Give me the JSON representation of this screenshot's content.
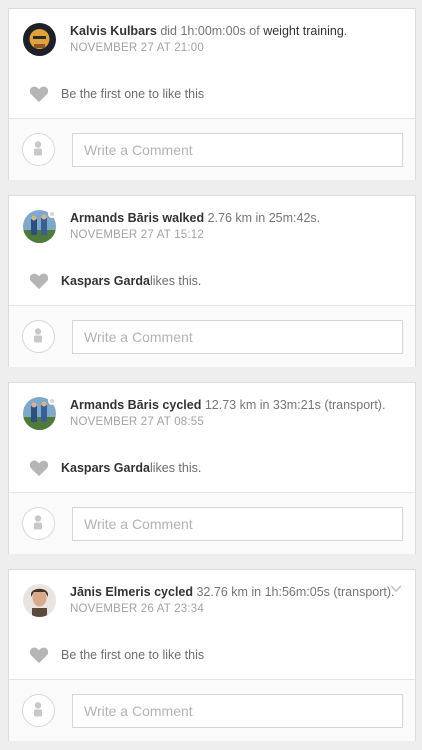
{
  "feed": [
    {
      "user": "Kalvis Kulbars",
      "verb": " did ",
      "detail": "1h:00m:00s of ",
      "activity": "weight training",
      "suffix": ".",
      "timestamp": "NOVEMBER 27 AT 21:00",
      "likes_name": "",
      "likes_text": "Be the first one to like this",
      "comment_placeholder": "Write a Comment"
    },
    {
      "user": "Armands Bāris",
      "verb": " walked ",
      "detail": "2.76 km in 25m:42s.",
      "activity": "",
      "suffix": "",
      "timestamp": "NOVEMBER 27 AT 15:12",
      "likes_name": "Kaspars Garda",
      "likes_text": " likes this.",
      "comment_placeholder": "Write a Comment"
    },
    {
      "user": "Armands Bāris",
      "verb": " cycled ",
      "detail": "12.73 km in 33m:21s (transport).",
      "activity": "",
      "suffix": "",
      "timestamp": "NOVEMBER 27 AT 08:55",
      "likes_name": "Kaspars Garda",
      "likes_text": " likes this.",
      "comment_placeholder": "Write a Comment"
    },
    {
      "user": "Jānis Elmeris",
      "verb": " cycled ",
      "detail": "32.76 km in 1h:56m:05s (transport).",
      "activity": "",
      "suffix": "",
      "timestamp": "NOVEMBER 26 AT 23:34",
      "likes_name": "",
      "likes_text": "Be the first one to like this",
      "comment_placeholder": "Write a Comment"
    }
  ],
  "icons": {
    "heart": "heart-icon",
    "comment_avatar": "user-placeholder-icon",
    "chevron": "chevron-down-icon"
  },
  "colors": {
    "heart": "#b5b5b5",
    "name": "#333333",
    "timestamp": "#a3a3a3"
  }
}
